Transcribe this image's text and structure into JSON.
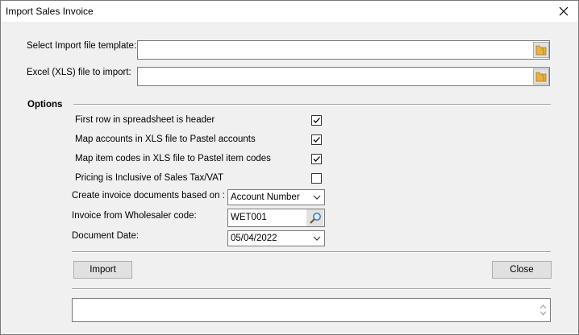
{
  "window": {
    "title": "Import Sales Invoice",
    "close_icon": "close-icon"
  },
  "template": {
    "label": "Select Import file template:",
    "value": "",
    "browse_icon": "folder-icon"
  },
  "excel": {
    "label": "Excel (XLS) file to import:",
    "value": "",
    "browse_icon": "folder-icon"
  },
  "options": {
    "heading": "Options",
    "items": [
      {
        "label": "First row in spreadsheet is header",
        "checked": true
      },
      {
        "label": "Map accounts in XLS file to Pastel accounts",
        "checked": true
      },
      {
        "label": "Map item codes in XLS file to Pastel item codes",
        "checked": true
      },
      {
        "label": "Pricing is Inclusive of Sales Tax/VAT",
        "checked": false
      }
    ],
    "based_on": {
      "label": "Create invoice documents based on :",
      "value": "Account Number"
    },
    "wholesaler": {
      "label": "Invoice from Wholesaler code:",
      "value": "WET001",
      "icon": "magnifier-icon"
    },
    "doc_date": {
      "label": "Document Date:",
      "value": "05/04/2022"
    }
  },
  "buttons": {
    "import": "Import",
    "close": "Close"
  },
  "status": {
    "value": ""
  },
  "colors": {
    "window_bg": "#f0f0f0",
    "button_bg": "#e1e1e1",
    "folder": "#e8b33c"
  }
}
